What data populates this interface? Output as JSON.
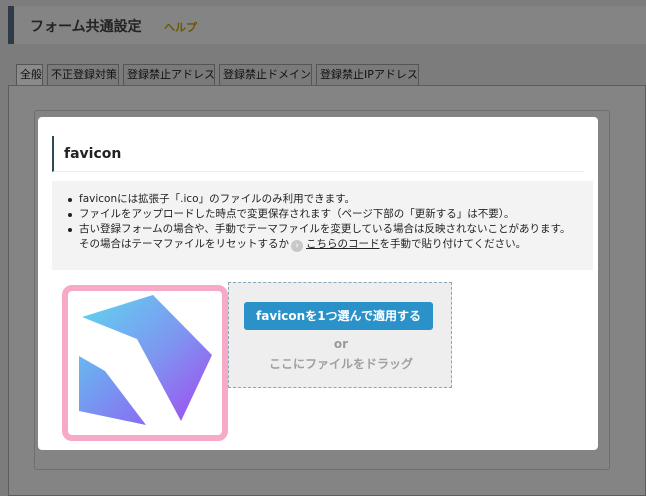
{
  "page": {
    "title": "フォーム共通設定",
    "help_label": "ヘルプ"
  },
  "tabs": [
    {
      "label": "全般",
      "active": true
    },
    {
      "label": "不正登録対策",
      "active": false
    },
    {
      "label": "登録禁止アドレス",
      "active": false
    },
    {
      "label": "登録禁止ドメイン",
      "active": false
    },
    {
      "label": "登録禁止IPアドレス",
      "active": false
    }
  ],
  "modal": {
    "title": "favicon",
    "notes": [
      "faviconには拡張子「.ico」のファイルのみ利用できます。",
      "ファイルをアップロードした時点で変更保存されます（ページ下部の「更新する」は不要）。",
      "古い登録フォームの場合や、手動でテーマファイルを変更している場合は反映されないことがあります。"
    ],
    "note3_cont_prefix": "その場合はテーマファイルをリセットするか",
    "note3_link": "こちらのコード",
    "note3_cont_suffix": "を手動で貼り付けてください。",
    "upload": {
      "button_label": "faviconを1つ選んで適用する",
      "or_label": "or",
      "drag_label": "ここにファイルをドラッグ"
    }
  },
  "colors": {
    "primary_button": "#2a91c9",
    "preview_border": "#f7a9c8",
    "overlay": "#7a7a7a"
  },
  "icons": {
    "chevron": "chevron-right-icon",
    "preview": "favicon-preview-image"
  }
}
